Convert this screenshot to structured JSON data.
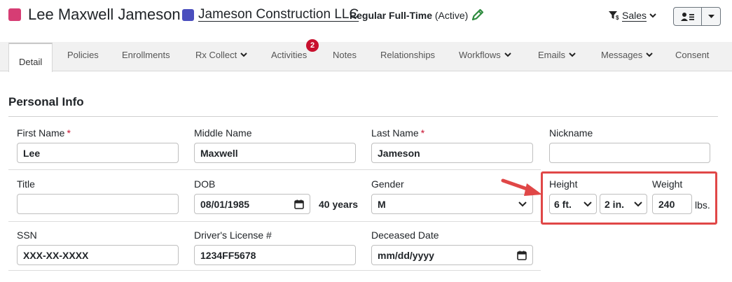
{
  "header": {
    "person_name": "Lee Maxwell Jameson",
    "person_color": "#d63d74",
    "company": "Jameson Construction LLC",
    "company_color": "#4b4fbe",
    "employment_type": "Regular Full-Time",
    "employment_status": "(Active)",
    "edit_icon": "pencil-icon",
    "sales_label": "Sales"
  },
  "tabs": [
    {
      "label": "Detail",
      "active": true
    },
    {
      "label": "Policies"
    },
    {
      "label": "Enrollments"
    },
    {
      "label": "Rx Collect",
      "dropdown": true
    },
    {
      "label": "Activities",
      "badge": "2"
    },
    {
      "label": "Notes"
    },
    {
      "label": "Relationships"
    },
    {
      "label": "Workflows",
      "dropdown": true
    },
    {
      "label": "Emails",
      "dropdown": true
    },
    {
      "label": "Messages",
      "dropdown": true
    },
    {
      "label": "Consent"
    }
  ],
  "section": {
    "title": "Personal Info"
  },
  "fields": {
    "first_name": {
      "label": "First Name",
      "required": "*",
      "value": "Lee"
    },
    "middle_name": {
      "label": "Middle Name",
      "value": "Maxwell"
    },
    "last_name": {
      "label": "Last Name",
      "required": "*",
      "value": "Jameson"
    },
    "nickname": {
      "label": "Nickname",
      "value": ""
    },
    "title": {
      "label": "Title",
      "value": ""
    },
    "dob": {
      "label": "DOB",
      "value": "08/01/1985",
      "age": "40 years"
    },
    "gender": {
      "label": "Gender",
      "value": "M"
    },
    "height": {
      "label": "Height",
      "feet": "6 ft.",
      "inches": "2 in."
    },
    "weight": {
      "label": "Weight",
      "value": "240",
      "unit": "lbs."
    },
    "ssn": {
      "label": "SSN",
      "value": "XXX-XX-XXXX"
    },
    "drivers_license": {
      "label": "Driver's License #",
      "value": "1234FF5678"
    },
    "deceased_date": {
      "label": "Deceased Date",
      "placeholder": "mm/dd/yyyy"
    }
  },
  "annotation": {
    "highlight_color": "#e04747"
  }
}
